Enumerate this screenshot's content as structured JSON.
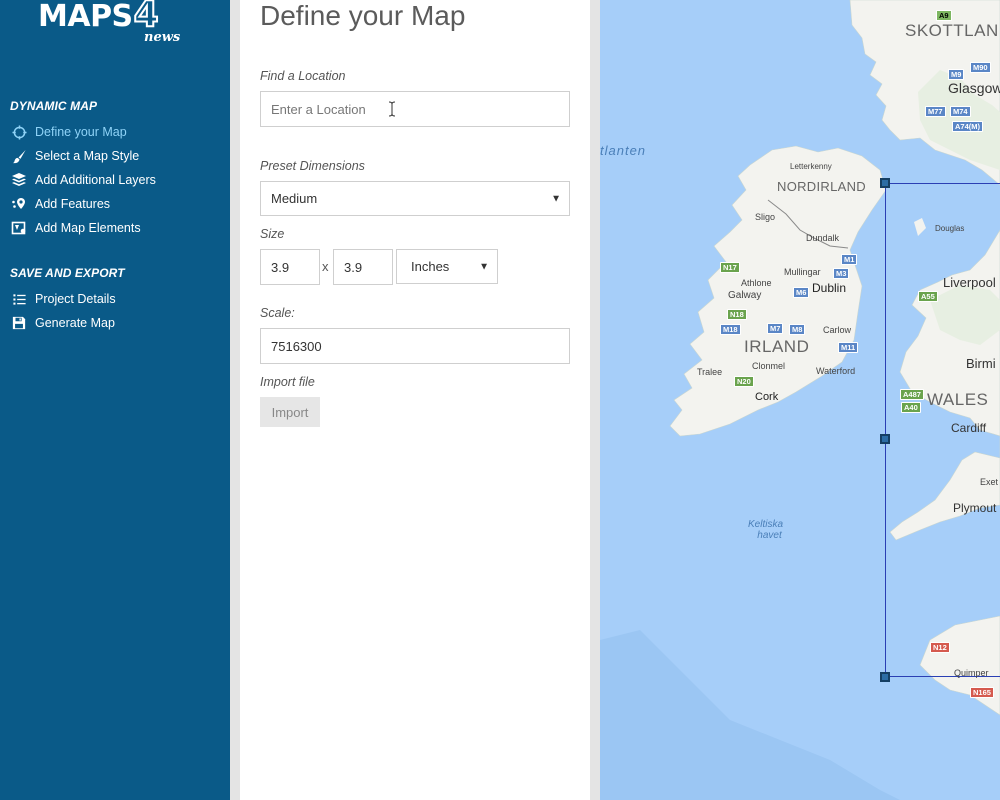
{
  "app": {
    "logo_main": "MAPS",
    "logo_digit": "4",
    "logo_sub": "news"
  },
  "sidebar": {
    "sections": [
      {
        "title": "DYNAMIC MAP",
        "items": [
          {
            "label": "Define your Map",
            "icon": "crosshair-icon",
            "active": true
          },
          {
            "label": "Select a Map Style",
            "icon": "brush-icon"
          },
          {
            "label": "Add Additional Layers",
            "icon": "layers-icon"
          },
          {
            "label": "Add Features",
            "icon": "pin-icon"
          },
          {
            "label": "Add Map Elements",
            "icon": "map-elements-icon"
          }
        ]
      },
      {
        "title": "SAVE AND EXPORT",
        "items": [
          {
            "label": "Project Details",
            "icon": "list-icon"
          },
          {
            "label": "Generate Map",
            "icon": "save-icon"
          }
        ]
      }
    ]
  },
  "form": {
    "title": "Define your Map",
    "find_location": {
      "label": "Find a Location",
      "placeholder": "Enter a Location"
    },
    "preset": {
      "label": "Preset Dimensions",
      "value": "Medium"
    },
    "size": {
      "label": "Size",
      "width": "3.9",
      "separator": "x",
      "height": "3.9",
      "unit": "Inches"
    },
    "scale": {
      "label": "Scale:",
      "value": "7516300"
    },
    "import": {
      "label": "Import file",
      "button": "Import"
    }
  },
  "map": {
    "labels": {
      "skotland": "SKOTTLAN",
      "atlanten": "tlanten",
      "letterkenny": "Letterkenny",
      "nordirland": "NORDIRLAND",
      "sligo": "Sligo",
      "dundalk": "Dundalk",
      "douglas": "Douglas",
      "glasgow": "Glasgow",
      "liverpool": "Liverpool",
      "mullingar": "Mullingar",
      "athlone": "Athlone",
      "galway": "Galway",
      "dublin": "Dublin",
      "irland": "IRLAND",
      "carlow": "Carlow",
      "clonmel": "Clonmel",
      "tralee": "Tralee",
      "waterford": "Waterford",
      "cork": "Cork",
      "birmi": "Birmi",
      "wales": "WALES",
      "cardiff": "Cardiff",
      "exet": "Exet",
      "plymouth": "Plymout",
      "sea_line1": "Keltiska",
      "sea_line2": "havet",
      "quimper": "Quimper"
    },
    "roads": [
      "A9",
      "M90",
      "M9",
      "M77",
      "M74",
      "A74(M)",
      "M1",
      "M3",
      "N17",
      "M6",
      "N18",
      "M18",
      "M7",
      "M8",
      "M11",
      "N20",
      "A55",
      "A487",
      "A40",
      "N12",
      "N165"
    ],
    "colors": {
      "sea": "#a6cef9",
      "land": "#f3f3ef",
      "selection": "#2a3fb4"
    }
  }
}
